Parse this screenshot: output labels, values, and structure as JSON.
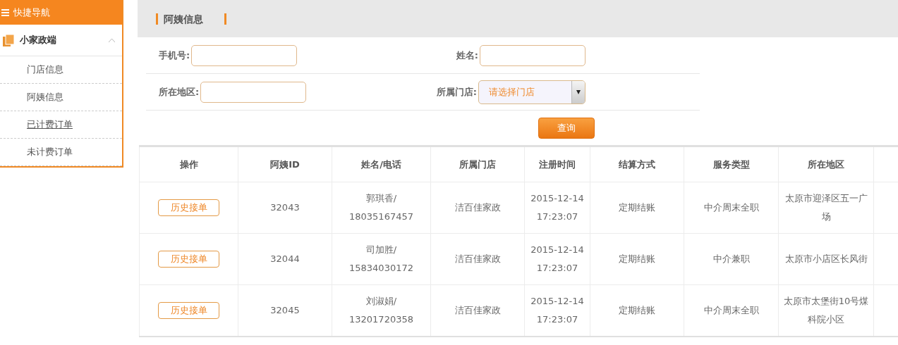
{
  "sidebar": {
    "title": "快捷导航",
    "section": {
      "label": "小家政端",
      "expanded": true
    },
    "items": [
      {
        "label": "门店信息",
        "selected": false
      },
      {
        "label": "阿姨信息",
        "selected": false
      },
      {
        "label": "已计费订单",
        "selected": true
      },
      {
        "label": "未计费订单",
        "selected": false
      }
    ]
  },
  "page_title": "阿姨信息",
  "form": {
    "fields": [
      {
        "kind": "input",
        "label": "手机号:"
      },
      {
        "kind": "input",
        "label": "姓名:"
      },
      {
        "kind": "input",
        "label": "所在地区:"
      },
      {
        "kind": "select",
        "label": "所属门店:",
        "placeholder": "请选择门店"
      }
    ],
    "submit": "查询"
  },
  "table": {
    "columns": [
      "操作",
      "阿姨ID",
      "姓名/电话",
      "所属门店",
      "注册时间",
      "结算方式",
      "服务类型",
      "所在地区"
    ],
    "rows": [
      {
        "action": "历史接单",
        "id": "32043",
        "name_phone": "郭琪香/ 18035167457",
        "store": "洁百佳家政",
        "registered": "2015-12-14 17:23:07",
        "settlement": "定期结账",
        "service": "中介周末全职",
        "region": "太原市迎泽区五一广场"
      },
      {
        "action": "历史接单",
        "id": "32044",
        "name_phone": "司加胜/ 15834030172",
        "store": "洁百佳家政",
        "registered": "2015-12-14 17:23:07",
        "settlement": "定期结账",
        "service": "中介兼职",
        "region": "太原市小店区长风街"
      },
      {
        "action": "历史接单",
        "id": "32045",
        "name_phone": "刘淑娟/ 13201720358",
        "store": "洁百佳家政",
        "registered": "2015-12-14 17:23:07",
        "settlement": "定期结账",
        "service": "中介周末全职",
        "region": "太原市太堡街10号煤科院小区"
      }
    ]
  }
}
